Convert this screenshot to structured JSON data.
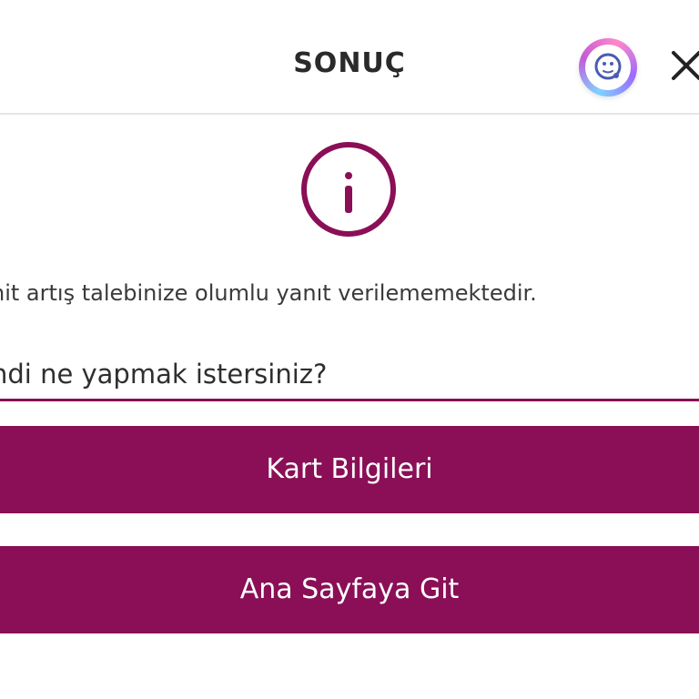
{
  "header": {
    "title": "SONUÇ",
    "assistant_icon": "chat-assistant-icon",
    "close_icon": "close-icon"
  },
  "body": {
    "info_icon": "info-icon",
    "message": "nit artış talebinize olumlu yanıt verilememektedir.",
    "question": "ndi ne yapmak istersiniz?"
  },
  "actions": {
    "card_info_label": "Kart Bilgileri",
    "home_label": "Ana Sayfaya Git"
  },
  "colors": {
    "accent": "#8a0f56",
    "text": "#2f2f2f",
    "divider": "#e6e6e6",
    "background": "#ffffff"
  }
}
